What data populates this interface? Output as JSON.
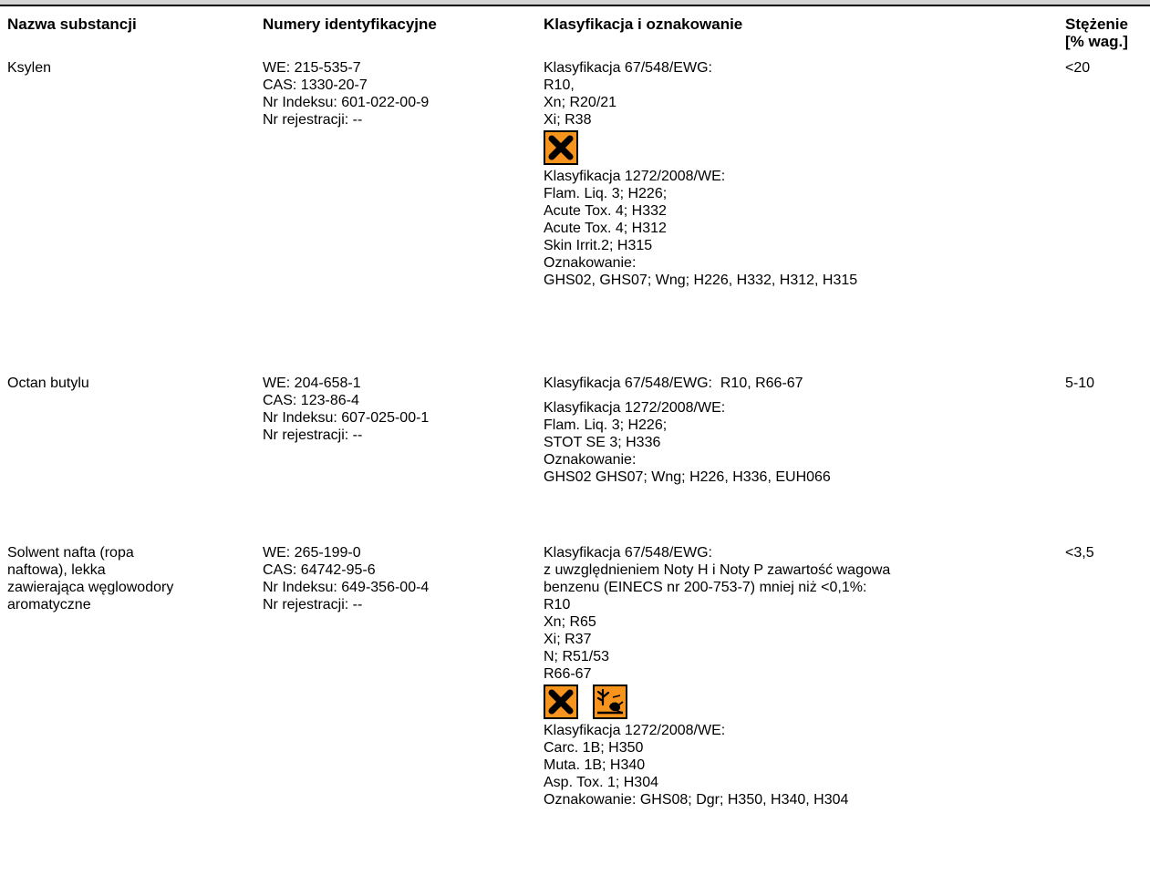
{
  "header": {
    "name": "Nazwa substancji",
    "ids": "Numery identyfikacyjne",
    "classification": "Klasyfikacja i oznakowanie",
    "concentration_line1": "Stężenie",
    "concentration_line2": "[% wag.]"
  },
  "rows": [
    {
      "name": [
        "Ksylen"
      ],
      "ids": [
        "WE: 215-535-7",
        "CAS: 1330-20-7",
        "Nr Indeksu: 601-022-00-9",
        "Nr rejestracji: --"
      ],
      "class_a": [
        "Klasyfikacja 67/548/EWG:",
        "R10,",
        "Xn; R20/21",
        "Xi; R38"
      ],
      "pictograms": [
        "harmful-x-pictogram"
      ],
      "class_b": [
        "Klasyfikacja 1272/2008/WE:",
        "Flam. Liq. 3; H226;",
        "Acute Tox. 4; H332",
        "Acute Tox. 4; H312",
        "Skin Irrit.2; H315",
        "Oznakowanie:",
        "GHS02, GHS07; Wng; H226, H332, H312, H315"
      ],
      "concentration": "<20"
    },
    {
      "name": [
        "Octan butylu"
      ],
      "ids": [
        "WE: 204-658-1",
        "CAS: 123-86-4",
        "Nr Indeksu: 607-025-00-1",
        "Nr rejestracji: --"
      ],
      "class_a": [
        "Klasyfikacja 67/548/EWG:  R10, R66-67"
      ],
      "class_b": [
        "Klasyfikacja 1272/2008/WE:",
        "Flam. Liq. 3; H226;",
        "STOT SE 3; H336",
        "Oznakowanie:",
        "GHS02 GHS07; Wng; H226, H336, EUH066"
      ],
      "concentration": "5-10"
    },
    {
      "name": [
        "Solwent nafta (ropa",
        "naftowa), lekka",
        "zawierająca węglowodory",
        "aromatyczne"
      ],
      "ids": [
        "WE: 265-199-0",
        "CAS: 64742-95-6",
        "Nr Indeksu: 649-356-00-4",
        "Nr rejestracji: --"
      ],
      "class_a": [
        "Klasyfikacja 67/548/EWG:",
        "z uwzględnieniem Noty H i Noty P zawartość wagowa",
        "benzenu (EINECS nr 200-753-7) mniej niż <0,1%:",
        "R10",
        "Xn; R65",
        "Xi; R37",
        "N; R51/53",
        "R66-67"
      ],
      "pictograms": [
        "harmful-x-pictogram",
        "environment-hazard-pictogram"
      ],
      "class_b": [
        "Klasyfikacja 1272/2008/WE:",
        "Carc. 1B; H350",
        "Muta. 1B; H340",
        "Asp. Tox. 1; H304",
        "Oznakowanie: GHS08; Dgr; H350, H340, H304"
      ],
      "concentration": "<3,5"
    }
  ],
  "colors": {
    "pictogram_fill": "#f7941d",
    "pictogram_border": "#000000",
    "top_band": "#d4d4d4"
  }
}
